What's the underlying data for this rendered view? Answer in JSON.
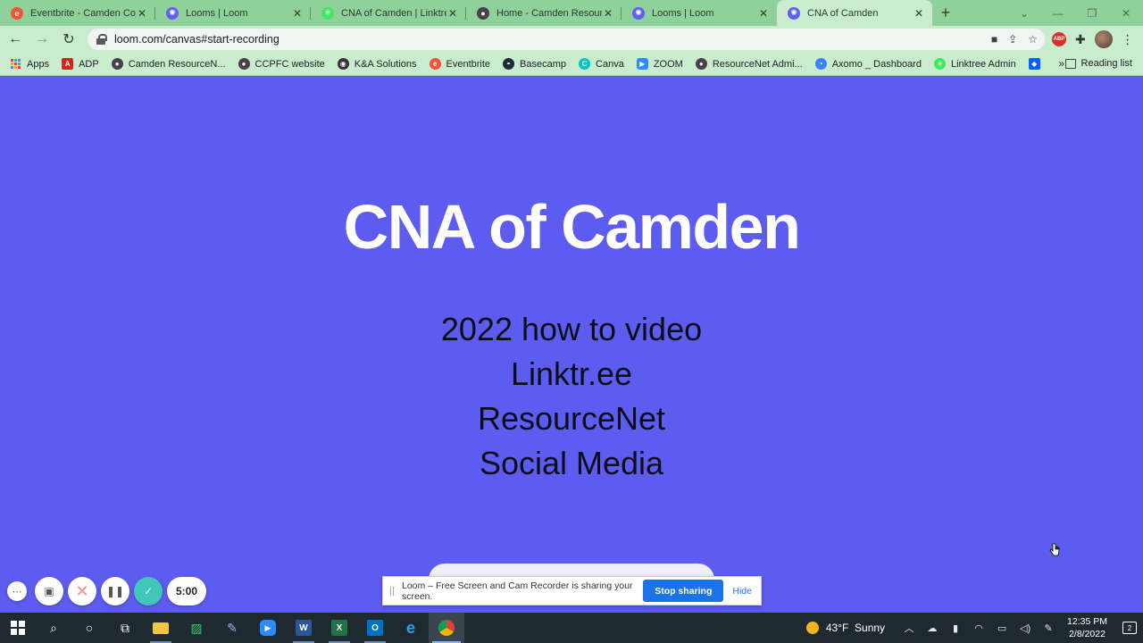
{
  "tabs": [
    {
      "title": "Eventbrite - Camden County",
      "favicon": "eventbrite-icon",
      "color": "#f05537",
      "glyph": "e"
    },
    {
      "title": "Looms | Loom",
      "favicon": "loom-icon",
      "color": "#625df5",
      "glyph": "✺"
    },
    {
      "title": "CNA of Camden | Linktree",
      "favicon": "linktree-icon",
      "color": "#43e660",
      "glyph": "✳"
    },
    {
      "title": "Home - Camden ResourceNet",
      "favicon": "resourcenet-icon",
      "color": "#4a3f4a",
      "glyph": "●"
    },
    {
      "title": "Looms | Loom",
      "favicon": "loom-icon",
      "color": "#625df5",
      "glyph": "✺"
    },
    {
      "title": "CNA of Camden",
      "favicon": "loom-icon",
      "color": "#625df5",
      "glyph": "✺"
    }
  ],
  "address": {
    "url": "loom.com/canvas#start-recording"
  },
  "bookmarks": [
    {
      "label": "Apps",
      "icon": "apps-grid-icon"
    },
    {
      "label": "ADP",
      "icon": "adp-icon",
      "color": "#d0271d",
      "glyph": "A"
    },
    {
      "label": "Camden ResourceN...",
      "icon": "resourcenet-icon",
      "color": "#4a3f4a",
      "glyph": "●"
    },
    {
      "label": "CCPFC website",
      "icon": "ccpfc-icon",
      "color": "#4a3f4a",
      "glyph": "●"
    },
    {
      "label": "K&A Solutions",
      "icon": "globe-icon",
      "color": "#333333",
      "glyph": "◉"
    },
    {
      "label": "Eventbrite",
      "icon": "eventbrite-icon",
      "color": "#f05537",
      "glyph": "e"
    },
    {
      "label": "Basecamp",
      "icon": "basecamp-icon",
      "color": "#1d2d35",
      "glyph": "◓"
    },
    {
      "label": "Canva",
      "icon": "canva-icon",
      "color": "#00c4cc",
      "glyph": "C"
    },
    {
      "label": "ZOOM",
      "icon": "zoom-icon",
      "color": "#2d8cff",
      "glyph": "▶"
    },
    {
      "label": "ResourceNet Admi...",
      "icon": "resourcenet-icon",
      "color": "#4a3f4a",
      "glyph": "●"
    },
    {
      "label": "Axomo _ Dashboard",
      "icon": "axomo-icon",
      "color": "#3b82f6",
      "glyph": "◔"
    },
    {
      "label": "Linktree Admin",
      "icon": "linktree-icon",
      "color": "#43e660",
      "glyph": "✳"
    },
    {
      "label": "",
      "icon": "dropbox-icon",
      "color": "#0061fe",
      "glyph": "◆"
    }
  ],
  "reading_list": "Reading list",
  "canvas": {
    "title": "CNA of Camden",
    "lines": [
      "2022 how to video",
      "Linktr.ee",
      "ResourceNet",
      "Social Media"
    ]
  },
  "recorder": {
    "timer": "5:00"
  },
  "share_bar": {
    "message": "Loom – Free Screen and Cam Recorder is sharing your screen.",
    "stop_label": "Stop sharing",
    "hide_label": "Hide"
  },
  "taskbar": {
    "weather_temp": "43°F",
    "weather_desc": "Sunny",
    "time": "12:35 PM",
    "date": "2/8/2022",
    "notifications": "2"
  },
  "colors": {
    "canvas_bg": "#5d5cf0",
    "chrome_green": "#8fd19b",
    "chrome_light": "#c9eccf",
    "accent_blue": "#1a73e8"
  }
}
